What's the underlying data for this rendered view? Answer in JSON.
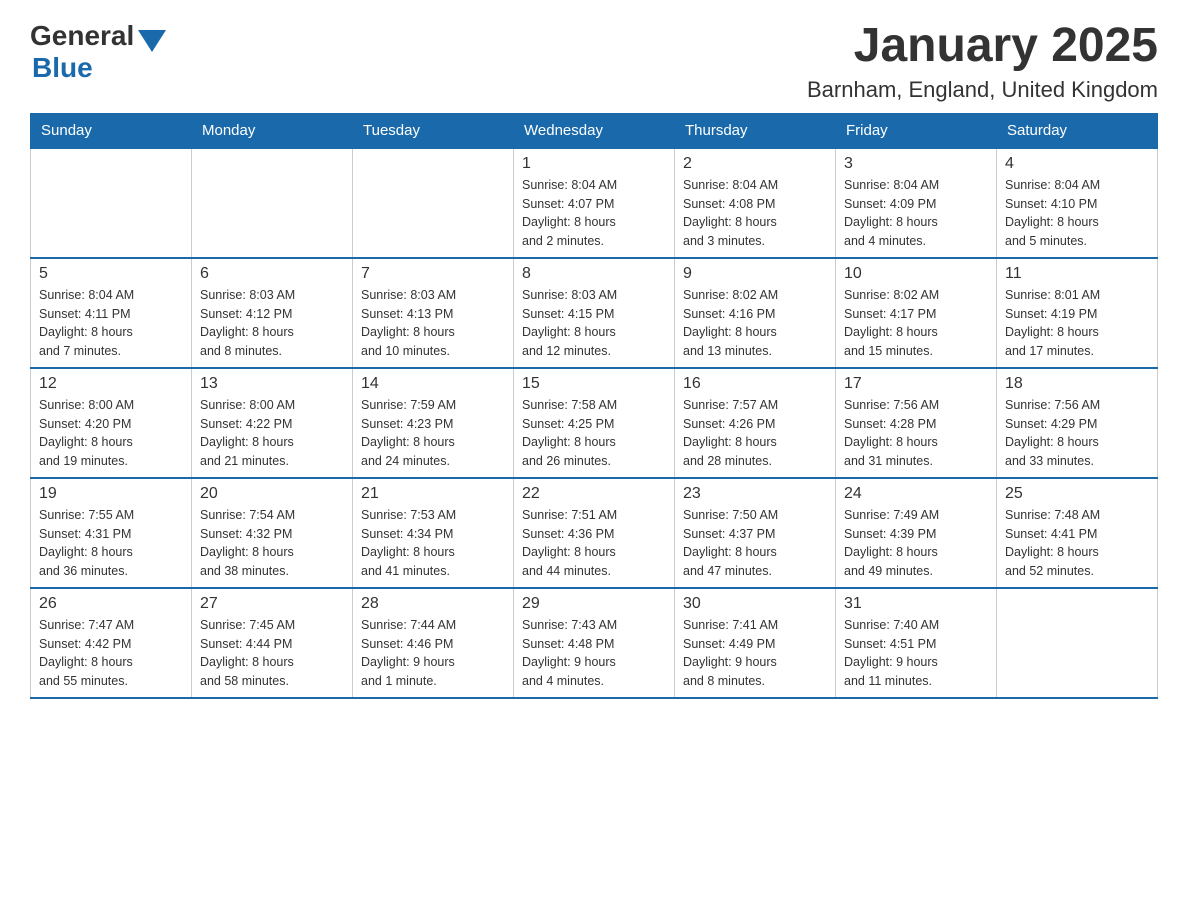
{
  "header": {
    "title": "January 2025",
    "subtitle": "Barnham, England, United Kingdom",
    "logo": {
      "general": "General",
      "blue": "Blue"
    }
  },
  "weekdays": [
    "Sunday",
    "Monday",
    "Tuesday",
    "Wednesday",
    "Thursday",
    "Friday",
    "Saturday"
  ],
  "weeks": [
    [
      {
        "day": "",
        "info": ""
      },
      {
        "day": "",
        "info": ""
      },
      {
        "day": "",
        "info": ""
      },
      {
        "day": "1",
        "info": "Sunrise: 8:04 AM\nSunset: 4:07 PM\nDaylight: 8 hours\nand 2 minutes."
      },
      {
        "day": "2",
        "info": "Sunrise: 8:04 AM\nSunset: 4:08 PM\nDaylight: 8 hours\nand 3 minutes."
      },
      {
        "day": "3",
        "info": "Sunrise: 8:04 AM\nSunset: 4:09 PM\nDaylight: 8 hours\nand 4 minutes."
      },
      {
        "day": "4",
        "info": "Sunrise: 8:04 AM\nSunset: 4:10 PM\nDaylight: 8 hours\nand 5 minutes."
      }
    ],
    [
      {
        "day": "5",
        "info": "Sunrise: 8:04 AM\nSunset: 4:11 PM\nDaylight: 8 hours\nand 7 minutes."
      },
      {
        "day": "6",
        "info": "Sunrise: 8:03 AM\nSunset: 4:12 PM\nDaylight: 8 hours\nand 8 minutes."
      },
      {
        "day": "7",
        "info": "Sunrise: 8:03 AM\nSunset: 4:13 PM\nDaylight: 8 hours\nand 10 minutes."
      },
      {
        "day": "8",
        "info": "Sunrise: 8:03 AM\nSunset: 4:15 PM\nDaylight: 8 hours\nand 12 minutes."
      },
      {
        "day": "9",
        "info": "Sunrise: 8:02 AM\nSunset: 4:16 PM\nDaylight: 8 hours\nand 13 minutes."
      },
      {
        "day": "10",
        "info": "Sunrise: 8:02 AM\nSunset: 4:17 PM\nDaylight: 8 hours\nand 15 minutes."
      },
      {
        "day": "11",
        "info": "Sunrise: 8:01 AM\nSunset: 4:19 PM\nDaylight: 8 hours\nand 17 minutes."
      }
    ],
    [
      {
        "day": "12",
        "info": "Sunrise: 8:00 AM\nSunset: 4:20 PM\nDaylight: 8 hours\nand 19 minutes."
      },
      {
        "day": "13",
        "info": "Sunrise: 8:00 AM\nSunset: 4:22 PM\nDaylight: 8 hours\nand 21 minutes."
      },
      {
        "day": "14",
        "info": "Sunrise: 7:59 AM\nSunset: 4:23 PM\nDaylight: 8 hours\nand 24 minutes."
      },
      {
        "day": "15",
        "info": "Sunrise: 7:58 AM\nSunset: 4:25 PM\nDaylight: 8 hours\nand 26 minutes."
      },
      {
        "day": "16",
        "info": "Sunrise: 7:57 AM\nSunset: 4:26 PM\nDaylight: 8 hours\nand 28 minutes."
      },
      {
        "day": "17",
        "info": "Sunrise: 7:56 AM\nSunset: 4:28 PM\nDaylight: 8 hours\nand 31 minutes."
      },
      {
        "day": "18",
        "info": "Sunrise: 7:56 AM\nSunset: 4:29 PM\nDaylight: 8 hours\nand 33 minutes."
      }
    ],
    [
      {
        "day": "19",
        "info": "Sunrise: 7:55 AM\nSunset: 4:31 PM\nDaylight: 8 hours\nand 36 minutes."
      },
      {
        "day": "20",
        "info": "Sunrise: 7:54 AM\nSunset: 4:32 PM\nDaylight: 8 hours\nand 38 minutes."
      },
      {
        "day": "21",
        "info": "Sunrise: 7:53 AM\nSunset: 4:34 PM\nDaylight: 8 hours\nand 41 minutes."
      },
      {
        "day": "22",
        "info": "Sunrise: 7:51 AM\nSunset: 4:36 PM\nDaylight: 8 hours\nand 44 minutes."
      },
      {
        "day": "23",
        "info": "Sunrise: 7:50 AM\nSunset: 4:37 PM\nDaylight: 8 hours\nand 47 minutes."
      },
      {
        "day": "24",
        "info": "Sunrise: 7:49 AM\nSunset: 4:39 PM\nDaylight: 8 hours\nand 49 minutes."
      },
      {
        "day": "25",
        "info": "Sunrise: 7:48 AM\nSunset: 4:41 PM\nDaylight: 8 hours\nand 52 minutes."
      }
    ],
    [
      {
        "day": "26",
        "info": "Sunrise: 7:47 AM\nSunset: 4:42 PM\nDaylight: 8 hours\nand 55 minutes."
      },
      {
        "day": "27",
        "info": "Sunrise: 7:45 AM\nSunset: 4:44 PM\nDaylight: 8 hours\nand 58 minutes."
      },
      {
        "day": "28",
        "info": "Sunrise: 7:44 AM\nSunset: 4:46 PM\nDaylight: 9 hours\nand 1 minute."
      },
      {
        "day": "29",
        "info": "Sunrise: 7:43 AM\nSunset: 4:48 PM\nDaylight: 9 hours\nand 4 minutes."
      },
      {
        "day": "30",
        "info": "Sunrise: 7:41 AM\nSunset: 4:49 PM\nDaylight: 9 hours\nand 8 minutes."
      },
      {
        "day": "31",
        "info": "Sunrise: 7:40 AM\nSunset: 4:51 PM\nDaylight: 9 hours\nand 11 minutes."
      },
      {
        "day": "",
        "info": ""
      }
    ]
  ]
}
